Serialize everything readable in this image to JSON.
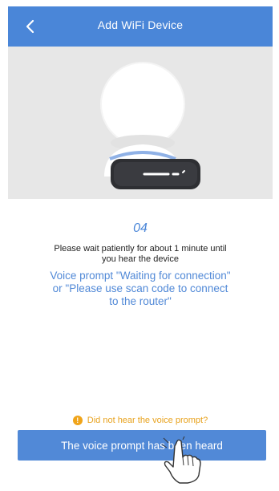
{
  "header": {
    "title": "Add WiFi Device",
    "back_icon": "chevron-left-icon"
  },
  "hero": {
    "image": "camera-device-illustration"
  },
  "content": {
    "step_number": "04",
    "instruction": "Please wait patiently for about 1 minute until you hear the device",
    "voice_prompt": "Voice prompt \"Waiting for connection\" or \"Please use scan code to connect to the router\""
  },
  "help": {
    "icon": "alert-icon",
    "link_label": "Did not hear the voice prompt?"
  },
  "actions": {
    "primary_label": "The voice prompt has been heard"
  },
  "colors": {
    "accent": "#4a86d8",
    "hero_bg": "#e7e7e7",
    "hint": "#e8a21d"
  }
}
